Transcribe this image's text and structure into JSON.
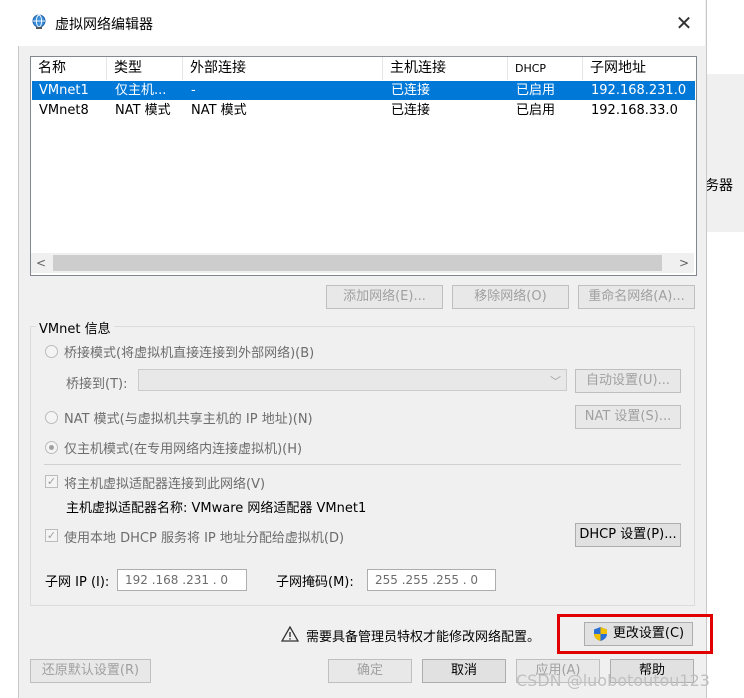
{
  "background_window": {
    "partial_text": "务器"
  },
  "dialog": {
    "title": "虚拟网络编辑器"
  },
  "network_list": {
    "columns": [
      "名称",
      "类型",
      "外部连接",
      "主机连接",
      "DHCP",
      "子网地址"
    ],
    "rows": [
      {
        "name": "VMnet1",
        "type": "仅主机...",
        "external": "-",
        "host": "已连接",
        "dhcp": "已启用",
        "subnet": "192.168.231.0",
        "selected": true
      },
      {
        "name": "VMnet8",
        "type": "NAT 模式",
        "external": "NAT 模式",
        "host": "已连接",
        "dhcp": "已启用",
        "subnet": "192.168.33.0",
        "selected": false
      }
    ],
    "scroll_left": "<",
    "scroll_right": ">"
  },
  "list_buttons": {
    "add": "添加网络(E)...",
    "remove": "移除网络(O)",
    "rename": "重命名网络(A)..."
  },
  "vmnet_info": {
    "label": "VMnet 信息",
    "bridge_mode": "桥接模式(将虚拟机直接连接到外部网络)(B)",
    "bridge_to": "桥接到(T):",
    "auto_settings": "自动设置(U)...",
    "nat_mode": "NAT 模式(与虚拟机共享主机的 IP 地址)(N)",
    "nat_settings": "NAT 设置(S)...",
    "host_only_mode": "仅主机模式(在专用网络内连接虚拟机)(H)",
    "connect_adapter": "将主机虚拟适配器连接到此网络(V)",
    "adapter_name": "主机虚拟适配器名称: VMware 网络适配器 VMnet1",
    "use_dhcp": "使用本地 DHCP 服务将 IP 地址分配给虚拟机(D)",
    "dhcp_settings": "DHCP 设置(P)...",
    "subnet_ip_label": "子网 IP (I):",
    "subnet_ip": "192 .168 .231 .  0",
    "subnet_mask_label": "子网掩码(M):",
    "subnet_mask": "255 .255 .255 .  0"
  },
  "footer": {
    "warning": "需要具备管理员特权才能修改网络配置。",
    "change_settings": "更改设置(C)",
    "restore_defaults": "还原默认设置(R)",
    "ok": "确定",
    "cancel": "取消",
    "apply": "应用(A)",
    "help": "帮助"
  },
  "watermark": "CSDN @luobotoutou123",
  "colors": {
    "selection": "#0078d7",
    "highlight_box": "#e00000"
  },
  "icons": {
    "title": "globe-network-icon",
    "close": "close-icon",
    "warning": "warning-triangle-icon",
    "admin": "uac-shield-icon"
  }
}
